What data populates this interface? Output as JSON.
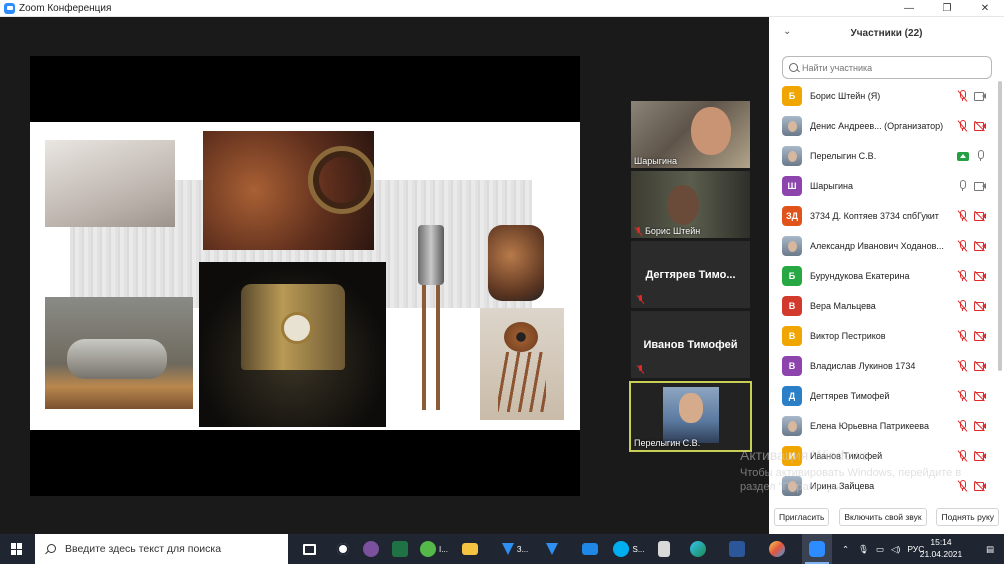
{
  "window": {
    "title": "Zoom Конференция",
    "controls": [
      "—",
      "❐",
      "✕"
    ]
  },
  "video_tiles": [
    {
      "name": "Шарыгина",
      "muted": false
    },
    {
      "name": "Борис Штейн",
      "muted": true
    },
    {
      "name": "Дегтярев Тимо...",
      "muted": true,
      "center_label": true
    },
    {
      "name": "Иванов Тимофей",
      "muted": true,
      "center_label": true
    },
    {
      "name": "Перелыгин С.В.",
      "muted": false,
      "active_speaker": true
    }
  ],
  "watermark": {
    "line1": "Активация Windows",
    "line2": "Чтобы активировать Windows, перейдите в раздел \"Параметры\"."
  },
  "participants_panel": {
    "title": "Участники (22)",
    "search_placeholder": "Найти участника",
    "participants": [
      {
        "name": "Борис Штейн (Я)",
        "initial": "Б",
        "avatar_color": "#f0a500",
        "mic": "muted",
        "video": "on",
        "share": false
      },
      {
        "name": "Денис Андреев...  (Организатор)",
        "initial": "",
        "avatar_color": "photo",
        "mic": "muted",
        "video": "off",
        "share": false
      },
      {
        "name": "Перелыгин С.В.",
        "initial": "",
        "avatar_color": "photo",
        "mic": "on",
        "video": "none",
        "share": true
      },
      {
        "name": "Шарыгина",
        "initial": "Ш",
        "avatar_color": "#8e44ad",
        "mic": "on",
        "video": "on",
        "share": false
      },
      {
        "name": "3734 Д. Коптяев 3734 спбГукит",
        "initial": "ЗД",
        "avatar_color": "#e0531a",
        "mic": "muted",
        "video": "off",
        "share": false
      },
      {
        "name": "Александр Иванович Ходанов...",
        "initial": "",
        "avatar_color": "photo",
        "mic": "muted",
        "video": "off",
        "share": false
      },
      {
        "name": "Бурундукова Екатерина",
        "initial": "Б",
        "avatar_color": "#27a844",
        "mic": "muted",
        "video": "off",
        "share": false
      },
      {
        "name": "Вера Мальцева",
        "initial": "В",
        "avatar_color": "#d23a2e",
        "mic": "muted",
        "video": "off",
        "share": false
      },
      {
        "name": "Виктор Пестриков",
        "initial": "В",
        "avatar_color": "#f0a500",
        "mic": "muted",
        "video": "off",
        "share": false
      },
      {
        "name": "Владислав Лукинов 1734",
        "initial": "В",
        "avatar_color": "#8e44ad",
        "mic": "muted",
        "video": "off",
        "share": false
      },
      {
        "name": "Дегтярев Тимофей",
        "initial": "Д",
        "avatar_color": "#2a7fc6",
        "mic": "muted",
        "video": "off",
        "share": false
      },
      {
        "name": "Елена Юрьевна Патрикеева",
        "initial": "",
        "avatar_color": "photo",
        "mic": "muted",
        "video": "off",
        "share": false
      },
      {
        "name": "Иванов Тимофей",
        "initial": "И",
        "avatar_color": "#f0a500",
        "mic": "muted",
        "video": "off",
        "share": false
      },
      {
        "name": "Ирина Зайцева",
        "initial": "",
        "avatar_color": "photo",
        "mic": "muted",
        "video": "off",
        "share": false
      }
    ],
    "buttons": {
      "invite": "Пригласить",
      "unmute": "Включить свой звук",
      "raise_hand": "Поднять руку"
    }
  },
  "taskbar": {
    "search_placeholder": "Введите здесь текст для поиска",
    "apps": [
      {
        "icon": "task-view-icon",
        "label": ""
      },
      {
        "icon": "settings-icon",
        "label": ""
      },
      {
        "icon": "viber-icon",
        "label": ""
      },
      {
        "icon": "excel-icon",
        "label": ""
      },
      {
        "icon": "icq-icon",
        "label": "I..."
      },
      {
        "icon": "file-explorer-icon",
        "label": ""
      },
      {
        "icon": "download-icon",
        "label": "З..."
      },
      {
        "icon": "download-icon",
        "label": ""
      },
      {
        "icon": "mail-icon",
        "label": ""
      },
      {
        "icon": "skype-icon",
        "label": "S..."
      },
      {
        "icon": "calculator-icon",
        "label": ""
      },
      {
        "icon": "edge-icon",
        "label": ""
      },
      {
        "icon": "word-icon",
        "label": ""
      },
      {
        "icon": "paint-icon",
        "label": ""
      },
      {
        "icon": "zoom-icon",
        "label": ""
      }
    ],
    "lang": "РУС",
    "time": "15:14",
    "date": "21.04.2021"
  }
}
